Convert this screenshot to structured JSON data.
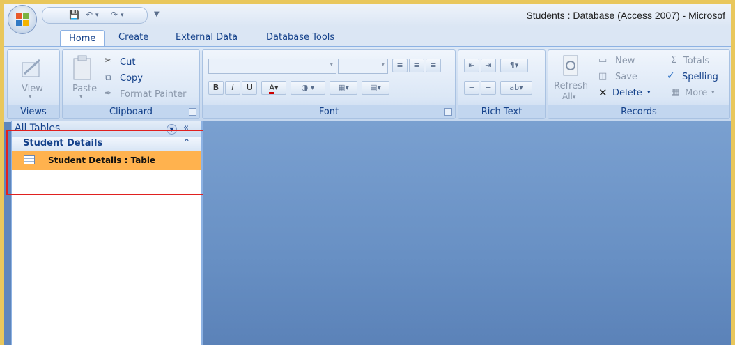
{
  "window": {
    "title": "Students : Database (Access 2007) - Microsof"
  },
  "tabs": [
    {
      "label": "Home",
      "active": true
    },
    {
      "label": "Create"
    },
    {
      "label": "External Data"
    },
    {
      "label": "Database Tools"
    }
  ],
  "ribbon": {
    "views": {
      "label": "Views",
      "view_button": "View"
    },
    "clipboard": {
      "label": "Clipboard",
      "paste": "Paste",
      "cut": "Cut",
      "copy": "Copy",
      "format_painter": "Format Painter"
    },
    "font": {
      "label": "Font",
      "bold": "B",
      "italic": "I",
      "underline": "U",
      "font_color": "A"
    },
    "rich_text": {
      "label": "Rich Text"
    },
    "records": {
      "label": "Records",
      "refresh": "Refresh",
      "refresh_all": "All",
      "new": "New",
      "save": "Save",
      "delete": "Delete",
      "totals": "Totals",
      "spelling": "Spelling",
      "more": "More"
    }
  },
  "navigation": {
    "header": "All Tables",
    "group_title": "Student Details",
    "items": [
      {
        "label": "Student Details : Table",
        "selected": true
      }
    ]
  },
  "colors": {
    "selection": "#ffb24e",
    "highlight_box": "#e0201f",
    "workspace": "#6890c4"
  }
}
